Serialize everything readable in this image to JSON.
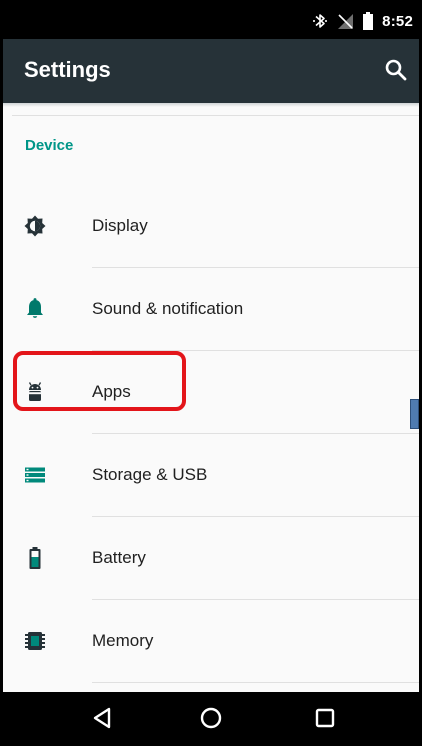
{
  "status_bar": {
    "time": "8:52",
    "icons": [
      "bluetooth-icon",
      "no-signal-icon",
      "battery-icon"
    ]
  },
  "app_bar": {
    "title": "Settings",
    "search_icon": "search-icon"
  },
  "section": {
    "header": "Device"
  },
  "items": [
    {
      "label": "Display",
      "icon": "brightness-icon"
    },
    {
      "label": "Sound & notification",
      "icon": "bell-icon"
    },
    {
      "label": "Apps",
      "icon": "android-icon",
      "highlighted": true
    },
    {
      "label": "Storage & USB",
      "icon": "storage-icon"
    },
    {
      "label": "Battery",
      "icon": "battery-icon"
    },
    {
      "label": "Memory",
      "icon": "memory-chip-icon"
    }
  ],
  "nav_bar": {
    "buttons": [
      "back-icon",
      "home-icon",
      "recents-icon"
    ]
  },
  "colors": {
    "app_bar": "#263238",
    "accent": "#009688",
    "highlight": "#e3151a",
    "background": "#fafafa"
  }
}
